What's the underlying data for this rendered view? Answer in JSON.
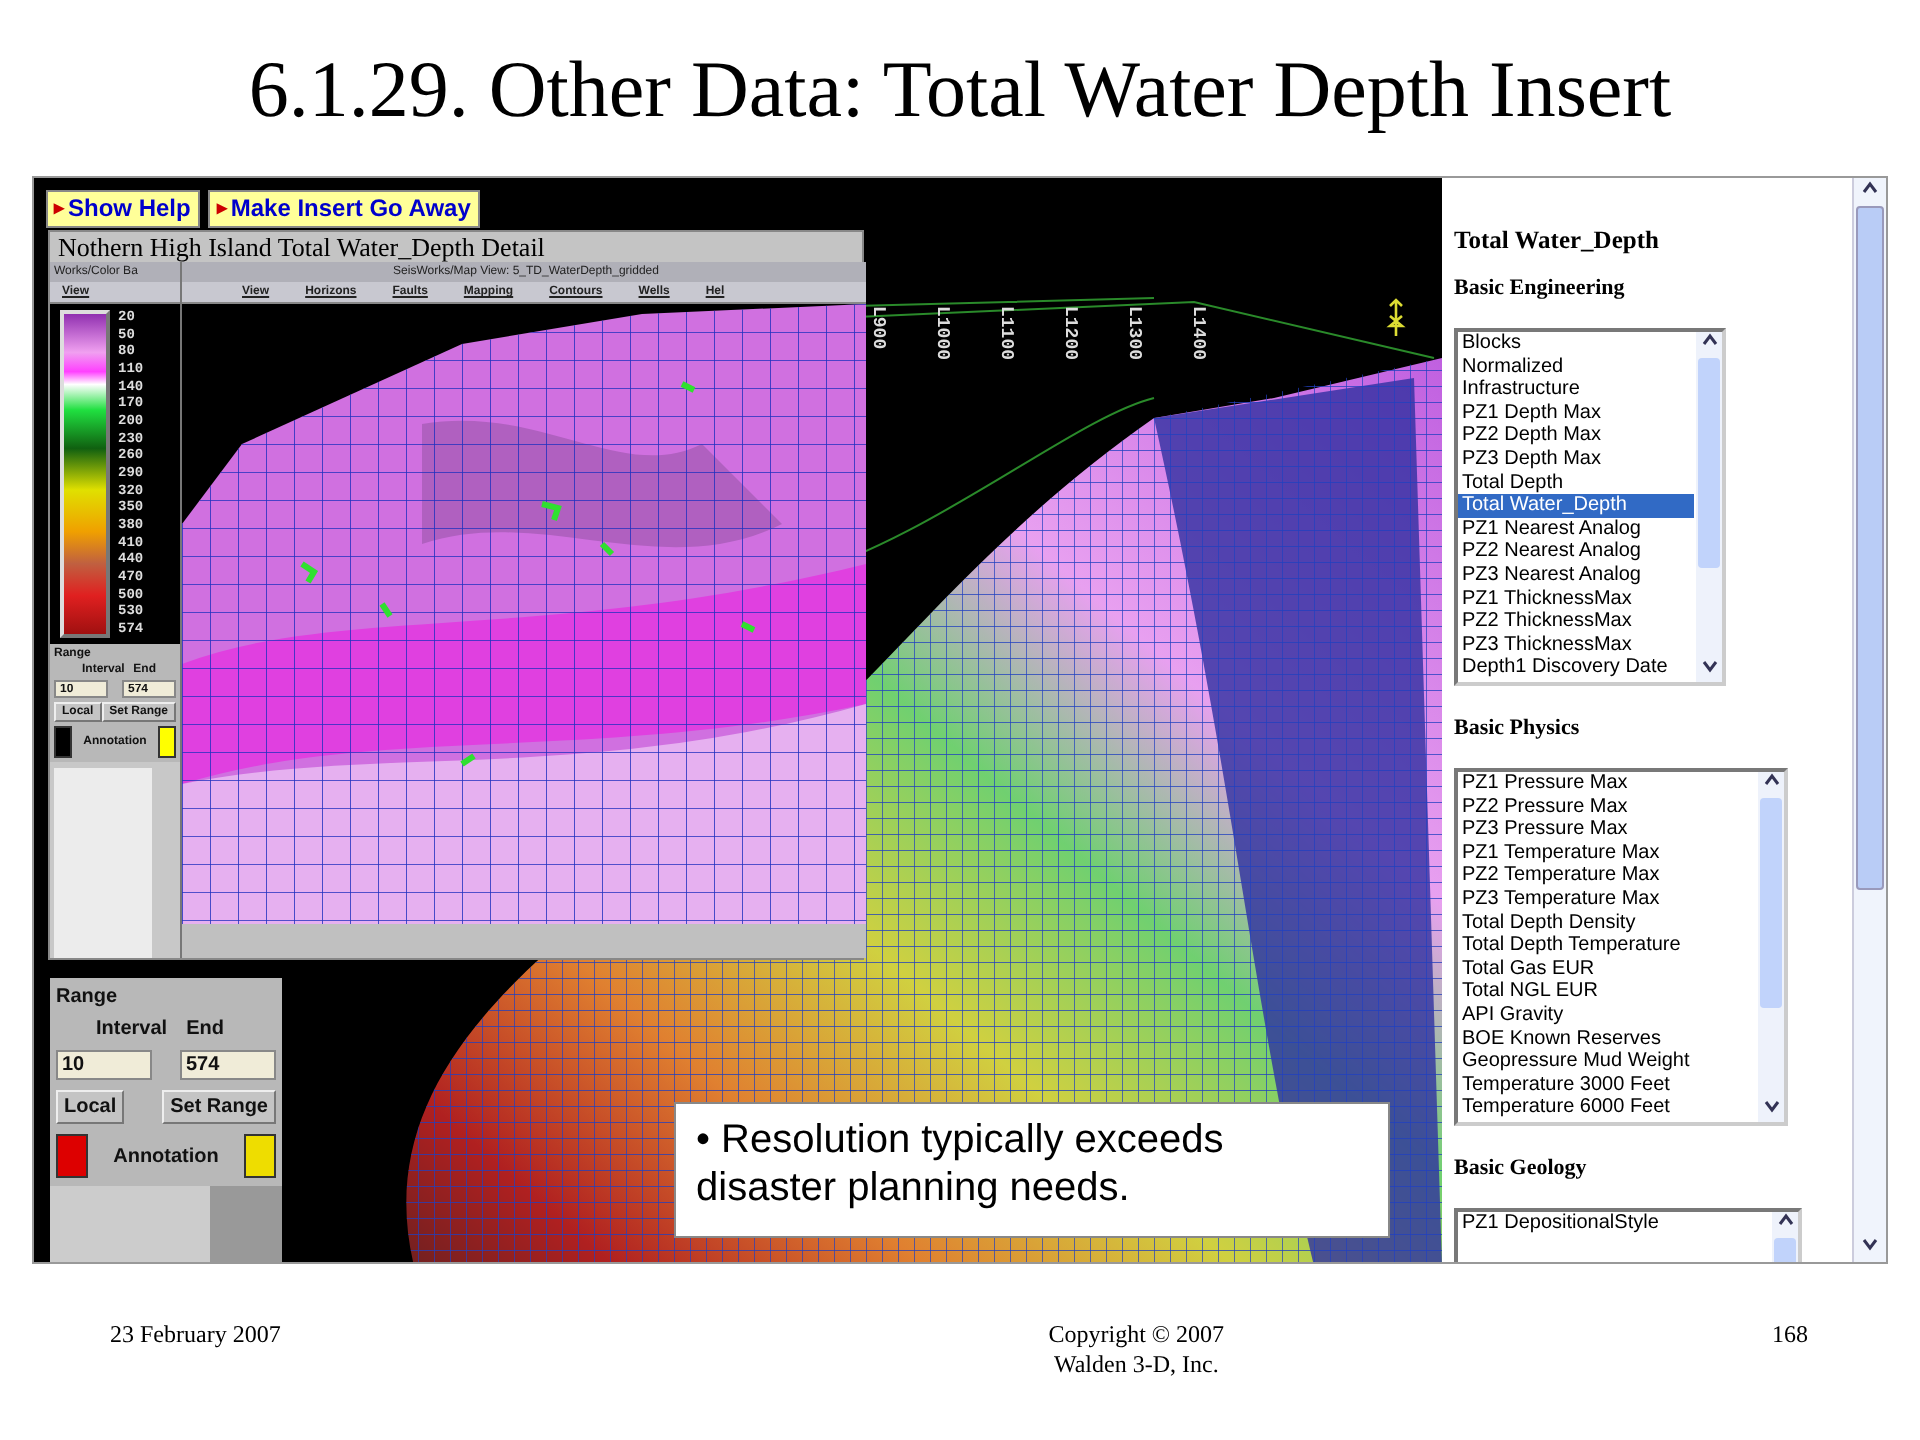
{
  "slide_title": "6.1.29. Other Data: Total Water Depth Insert",
  "buttons": [
    {
      "label": "Show Help",
      "icon": "▸"
    },
    {
      "label": "Make Insert Go Away",
      "icon": "▸"
    }
  ],
  "inset": {
    "title": "Nothern High Island Total Water_Depth Detail",
    "color_window": {
      "title": "Works/Color Ba",
      "menu": [
        "View"
      ],
      "scale_labels": [
        "20",
        "50",
        "80",
        "110",
        "140",
        "170",
        "200",
        "230",
        "260",
        "290",
        "320",
        "350",
        "380",
        "410",
        "440",
        "470",
        "500",
        "530",
        "574"
      ],
      "range": {
        "title": "Range",
        "interval_label": "Interval",
        "end_label": "End",
        "interval": "10",
        "end": "574",
        "mode": "Local",
        "button": "Set Range",
        "annotation": "Annotation",
        "swatches": [
          {
            "color": "#000000"
          },
          {
            "color": "#ffff00"
          }
        ]
      }
    },
    "map_window": {
      "title": "SeisWorks/Map View: 5_TD_WaterDepth_gridded",
      "menu": [
        "View",
        "Horizons",
        "Faults",
        "Mapping",
        "Contours",
        "Wells",
        "Hel"
      ]
    }
  },
  "range_panel": {
    "title": "Range",
    "interval_label": "Interval",
    "end_label": "End",
    "interval": "10",
    "end": "574",
    "mode": "Local",
    "button": "Set Range",
    "annotation": "Annotation",
    "swatches": [
      {
        "color": "#dd0000"
      },
      {
        "color": "#eedd00"
      }
    ]
  },
  "map": {
    "line_labels": [
      "L900",
      "L1000",
      "L1100",
      "L1200",
      "L1300",
      "L1400"
    ]
  },
  "callout": "• Resolution typically exceeds disaster planning needs.",
  "sidebar": {
    "heading": "Total Water_Depth",
    "sections": [
      {
        "title": "Basic Engineering",
        "items": [
          {
            "label": "Blocks",
            "selected": false
          },
          {
            "label": "Normalized",
            "selected": false
          },
          {
            "label": "Infrastructure",
            "selected": false
          },
          {
            "label": "PZ1 Depth Max",
            "selected": false
          },
          {
            "label": "PZ2 Depth Max",
            "selected": false
          },
          {
            "label": "PZ3 Depth Max",
            "selected": false
          },
          {
            "label": "Total Depth",
            "selected": false
          },
          {
            "label": "Total Water_Depth",
            "selected": true
          },
          {
            "label": "PZ1 Nearest Analog",
            "selected": false
          },
          {
            "label": "PZ2 Nearest Analog",
            "selected": false
          },
          {
            "label": "PZ3 Nearest Analog",
            "selected": false
          },
          {
            "label": "PZ1 ThicknessMax",
            "selected": false
          },
          {
            "label": "PZ2 ThicknessMax",
            "selected": false
          },
          {
            "label": "PZ3 ThicknessMax",
            "selected": false
          },
          {
            "label": "Depth1 Discovery Date",
            "selected": false
          }
        ]
      },
      {
        "title": "Basic Physics",
        "items": [
          {
            "label": "PZ1 Pressure Max",
            "selected": false
          },
          {
            "label": "PZ2 Pressure Max",
            "selected": false
          },
          {
            "label": "PZ3 Pressure Max",
            "selected": false
          },
          {
            "label": "PZ1 Temperature Max",
            "selected": false
          },
          {
            "label": "PZ2 Temperature Max",
            "selected": false
          },
          {
            "label": "PZ3 Temperature Max",
            "selected": false
          },
          {
            "label": "Total Depth Density",
            "selected": false
          },
          {
            "label": "Total Depth Temperature",
            "selected": false
          },
          {
            "label": "Total Gas EUR",
            "selected": false
          },
          {
            "label": "Total NGL EUR",
            "selected": false
          },
          {
            "label": "API Gravity",
            "selected": false
          },
          {
            "label": "BOE Known Reserves",
            "selected": false
          },
          {
            "label": "Geopressure Mud Weight",
            "selected": false
          },
          {
            "label": "Temperature 3000 Feet",
            "selected": false
          },
          {
            "label": "Temperature 6000 Feet",
            "selected": false
          }
        ]
      },
      {
        "title": "Basic Geology",
        "items": [
          {
            "label": "PZ1 DepositionalStyle",
            "selected": false
          }
        ]
      }
    ]
  },
  "footer": {
    "date": "23 February 2007",
    "copyright": [
      "Copyright © 2007",
      "Walden 3-D, Inc."
    ],
    "page": "168"
  }
}
